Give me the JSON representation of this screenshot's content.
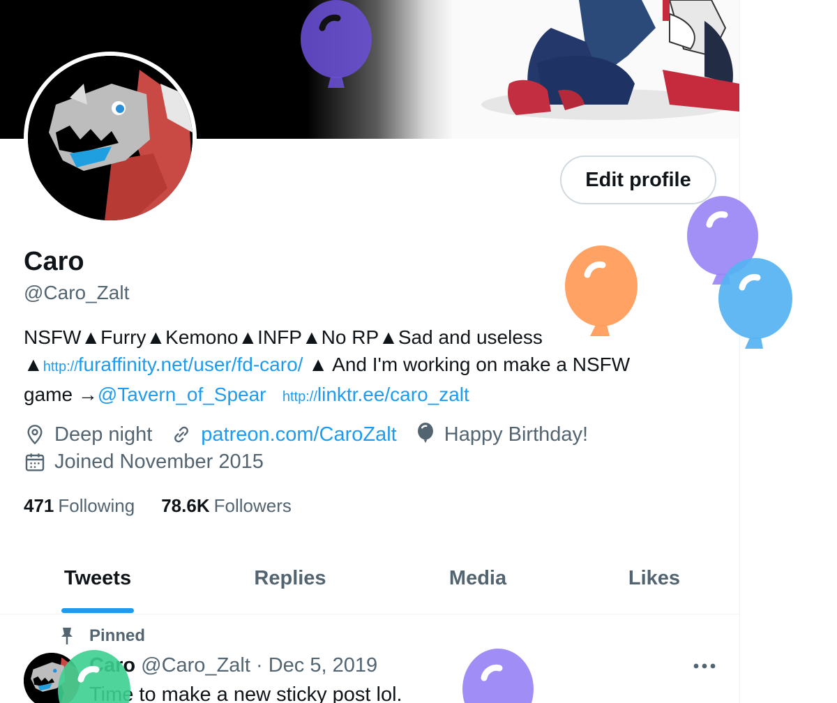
{
  "profile": {
    "display_name": "Caro",
    "handle": "@Caro_Zalt",
    "edit_button": "Edit profile",
    "bio": {
      "line1": "NSFW▲Furry▲Kemono▲INFP▲No RP▲Sad and useless",
      "line2_prefix": "▲",
      "link1_proto": "http://",
      "link1_text": "furaffinity.net/user/fd-caro/",
      "line2_suffix": " ▲ And I'm working on make a NSFW",
      "line3_prefix": "game →",
      "mention": "@Tavern_of_Spear",
      "link2_proto": "http://",
      "link2_text": "linktr.ee/caro_zalt"
    },
    "location": "Deep night",
    "website": "patreon.com/CaroZalt",
    "birthday": "Happy Birthday!",
    "joined": "Joined November 2015",
    "following_count": "471",
    "following_label": "Following",
    "followers_count": "78.6K",
    "followers_label": "Followers"
  },
  "tabs": [
    {
      "label": "Tweets",
      "active": true
    },
    {
      "label": "Replies",
      "active": false
    },
    {
      "label": "Media",
      "active": false
    },
    {
      "label": "Likes",
      "active": false
    }
  ],
  "pinned_tweet": {
    "pinned_label": "Pinned",
    "author_name": "Caro",
    "author_handle": "@Caro_Zalt",
    "separator": "·",
    "date": "Dec 5, 2019",
    "text": "Time to make a new sticky post lol."
  },
  "icons": {
    "location": "location-pin-icon",
    "website": "link-icon",
    "birthday": "balloon-icon",
    "joined": "calendar-icon",
    "pinned": "pin-icon",
    "more": "more-dots-icon"
  },
  "colors": {
    "accent": "#1d9bf0",
    "text_primary": "#0f1419",
    "text_secondary": "#536471",
    "balloon_purple": "#7856ff",
    "balloon_orange": "#ff7a00",
    "balloon_blue": "#1d9bf0",
    "balloon_green": "#00ba7c"
  }
}
